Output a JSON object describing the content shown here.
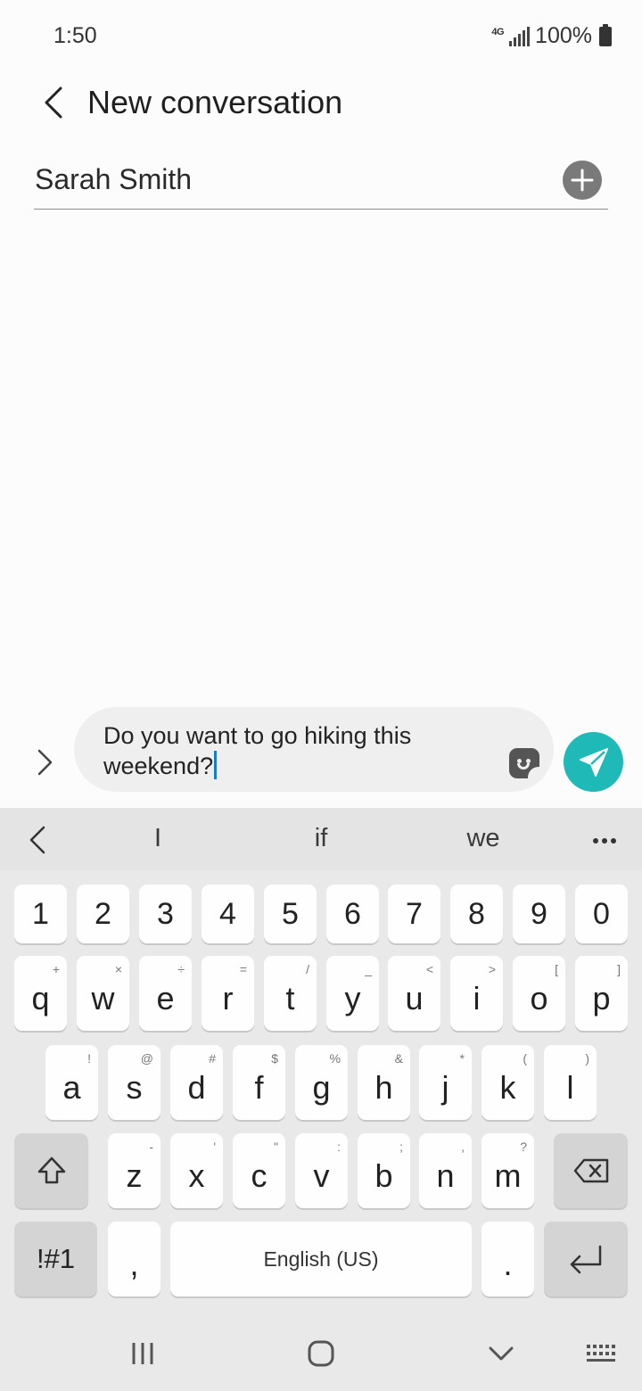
{
  "status_bar": {
    "time": "1:50",
    "network": "4G",
    "battery": "100%"
  },
  "header": {
    "title": "New conversation"
  },
  "recipient": {
    "name": "Sarah Smith"
  },
  "compose": {
    "line1": "Do you want to go hiking this",
    "line2": "weekend?"
  },
  "keyboard": {
    "suggestions": [
      "I",
      "if",
      "we"
    ],
    "number_row": [
      "1",
      "2",
      "3",
      "4",
      "5",
      "6",
      "7",
      "8",
      "9",
      "0"
    ],
    "row1": [
      {
        "key": "q",
        "hint": "+"
      },
      {
        "key": "w",
        "hint": "×"
      },
      {
        "key": "e",
        "hint": "÷"
      },
      {
        "key": "r",
        "hint": "="
      },
      {
        "key": "t",
        "hint": "/"
      },
      {
        "key": "y",
        "hint": "_"
      },
      {
        "key": "u",
        "hint": "<"
      },
      {
        "key": "i",
        "hint": ">"
      },
      {
        "key": "o",
        "hint": "["
      },
      {
        "key": "p",
        "hint": "]"
      }
    ],
    "row2": [
      {
        "key": "a",
        "hint": "!"
      },
      {
        "key": "s",
        "hint": "@"
      },
      {
        "key": "d",
        "hint": "#"
      },
      {
        "key": "f",
        "hint": "$"
      },
      {
        "key": "g",
        "hint": "%"
      },
      {
        "key": "h",
        "hint": "&"
      },
      {
        "key": "j",
        "hint": "*"
      },
      {
        "key": "k",
        "hint": "("
      },
      {
        "key": "l",
        "hint": ")"
      }
    ],
    "row3": [
      {
        "key": "z",
        "hint": "-"
      },
      {
        "key": "x",
        "hint": "'"
      },
      {
        "key": "c",
        "hint": "\""
      },
      {
        "key": "v",
        "hint": ":"
      },
      {
        "key": "b",
        "hint": ";"
      },
      {
        "key": "n",
        "hint": ","
      },
      {
        "key": "m",
        "hint": "?"
      }
    ],
    "symbols_key": "!#1",
    "comma_key": ",",
    "space_label": "English (US)",
    "period_key": "."
  },
  "icons": {
    "back": "chevron-left-icon",
    "add": "plus-circle-icon",
    "expand": "chevron-right-icon",
    "sticker": "sticker-icon",
    "send": "send-icon",
    "shift": "shift-icon",
    "backspace": "backspace-icon",
    "enter": "enter-icon",
    "nav_recent": "recent-apps-icon",
    "nav_home": "home-icon",
    "nav_hide": "hide-keyboard-icon",
    "nav_keyboard": "keyboard-switch-icon"
  },
  "colors": {
    "accent": "#1fb9b7",
    "background": "#fcfcfc",
    "keyboard": "#e9e9e9",
    "cursor": "#1a7ac2"
  }
}
